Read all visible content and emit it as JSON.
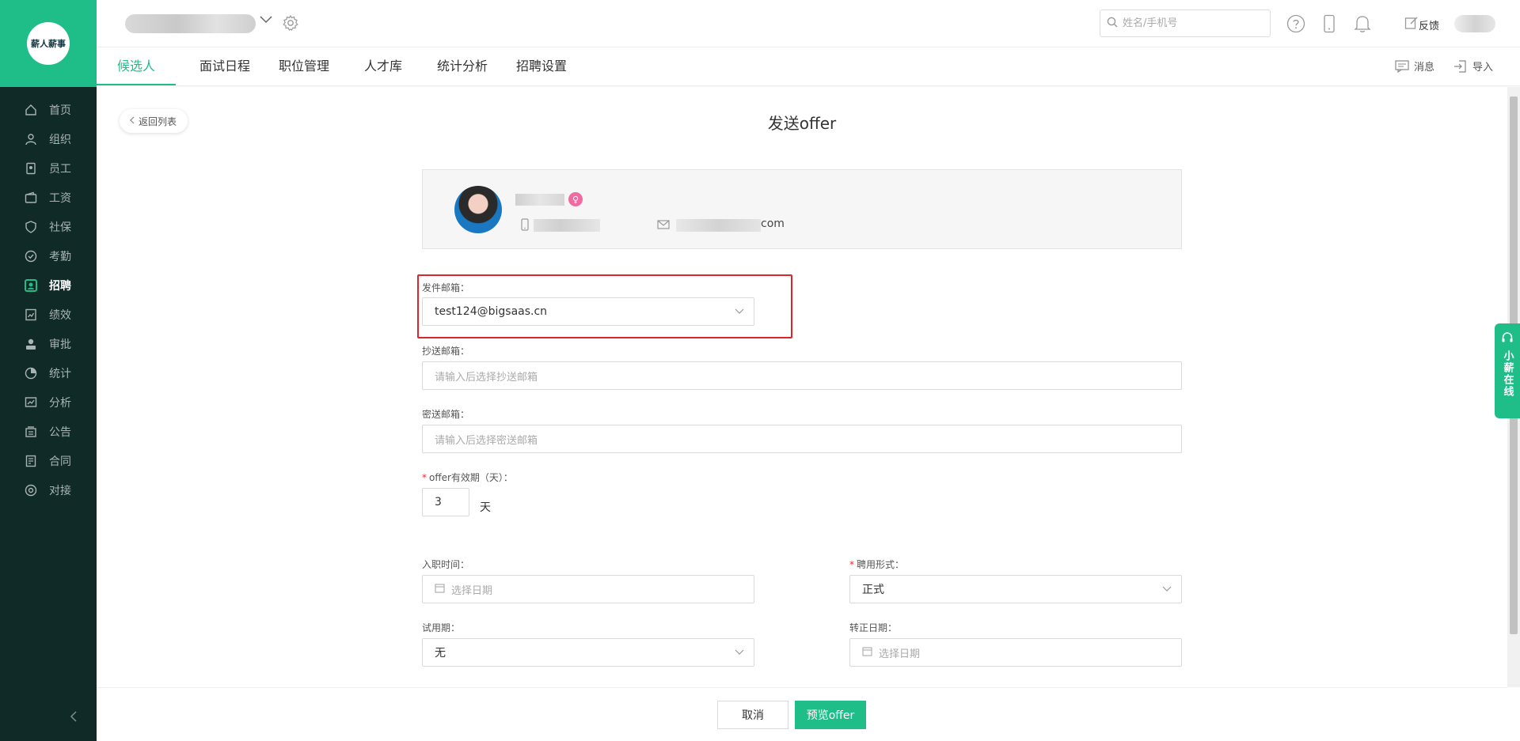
{
  "brand": {
    "logo_text": "薪人薪事",
    "accent": "#1fbe89",
    "sidebar_bg": "#0f2a27"
  },
  "sidebar": {
    "items": [
      {
        "label": "首页",
        "icon": "home-icon"
      },
      {
        "label": "组织",
        "icon": "org-icon"
      },
      {
        "label": "员工",
        "icon": "employee-icon"
      },
      {
        "label": "工资",
        "icon": "wallet-icon"
      },
      {
        "label": "社保",
        "icon": "shield-icon"
      },
      {
        "label": "考勤",
        "icon": "check-circle-icon"
      },
      {
        "label": "招聘",
        "icon": "recruit-icon",
        "active": true
      },
      {
        "label": "绩效",
        "icon": "performance-icon"
      },
      {
        "label": "审批",
        "icon": "approval-icon"
      },
      {
        "label": "统计",
        "icon": "pie-icon"
      },
      {
        "label": "分析",
        "icon": "analysis-icon"
      },
      {
        "label": "公告",
        "icon": "announcement-icon"
      },
      {
        "label": "合同",
        "icon": "contract-icon"
      },
      {
        "label": "对接",
        "icon": "connect-icon"
      }
    ]
  },
  "topbar": {
    "search_placeholder": "姓名/手机号",
    "feedback_label": "反馈"
  },
  "tabs": {
    "items": [
      "候选人",
      "面试日程",
      "职位管理",
      "人才库",
      "统计分析",
      "招聘设置"
    ],
    "active": "候选人",
    "messages_label": "消息",
    "import_label": "导入"
  },
  "page": {
    "back_label": "返回列表",
    "title": "发送offer"
  },
  "candidate": {
    "email_suffix": "com"
  },
  "form": {
    "sender_label": "发件邮箱：",
    "sender_value": "test124@bigsaas.cn",
    "cc_label": "抄送邮箱：",
    "cc_placeholder": "请输入后选择抄送邮箱",
    "bcc_label": "密送邮箱：",
    "bcc_placeholder": "请输入后选择密送邮箱",
    "validity_label": "offer有效期（天）：",
    "validity_value": "3",
    "validity_unit": "天",
    "entry_date_label": "入职时间：",
    "entry_date_placeholder": "选择日期",
    "employment_type_label": "聘用形式：",
    "employment_type_value": "正式",
    "probation_label": "试用期：",
    "probation_value": "无",
    "regular_date_label": "转正日期：",
    "regular_date_placeholder": "选择日期"
  },
  "footer": {
    "cancel_label": "取消",
    "preview_label": "预览offer"
  },
  "online": {
    "label": "小薪在线"
  }
}
